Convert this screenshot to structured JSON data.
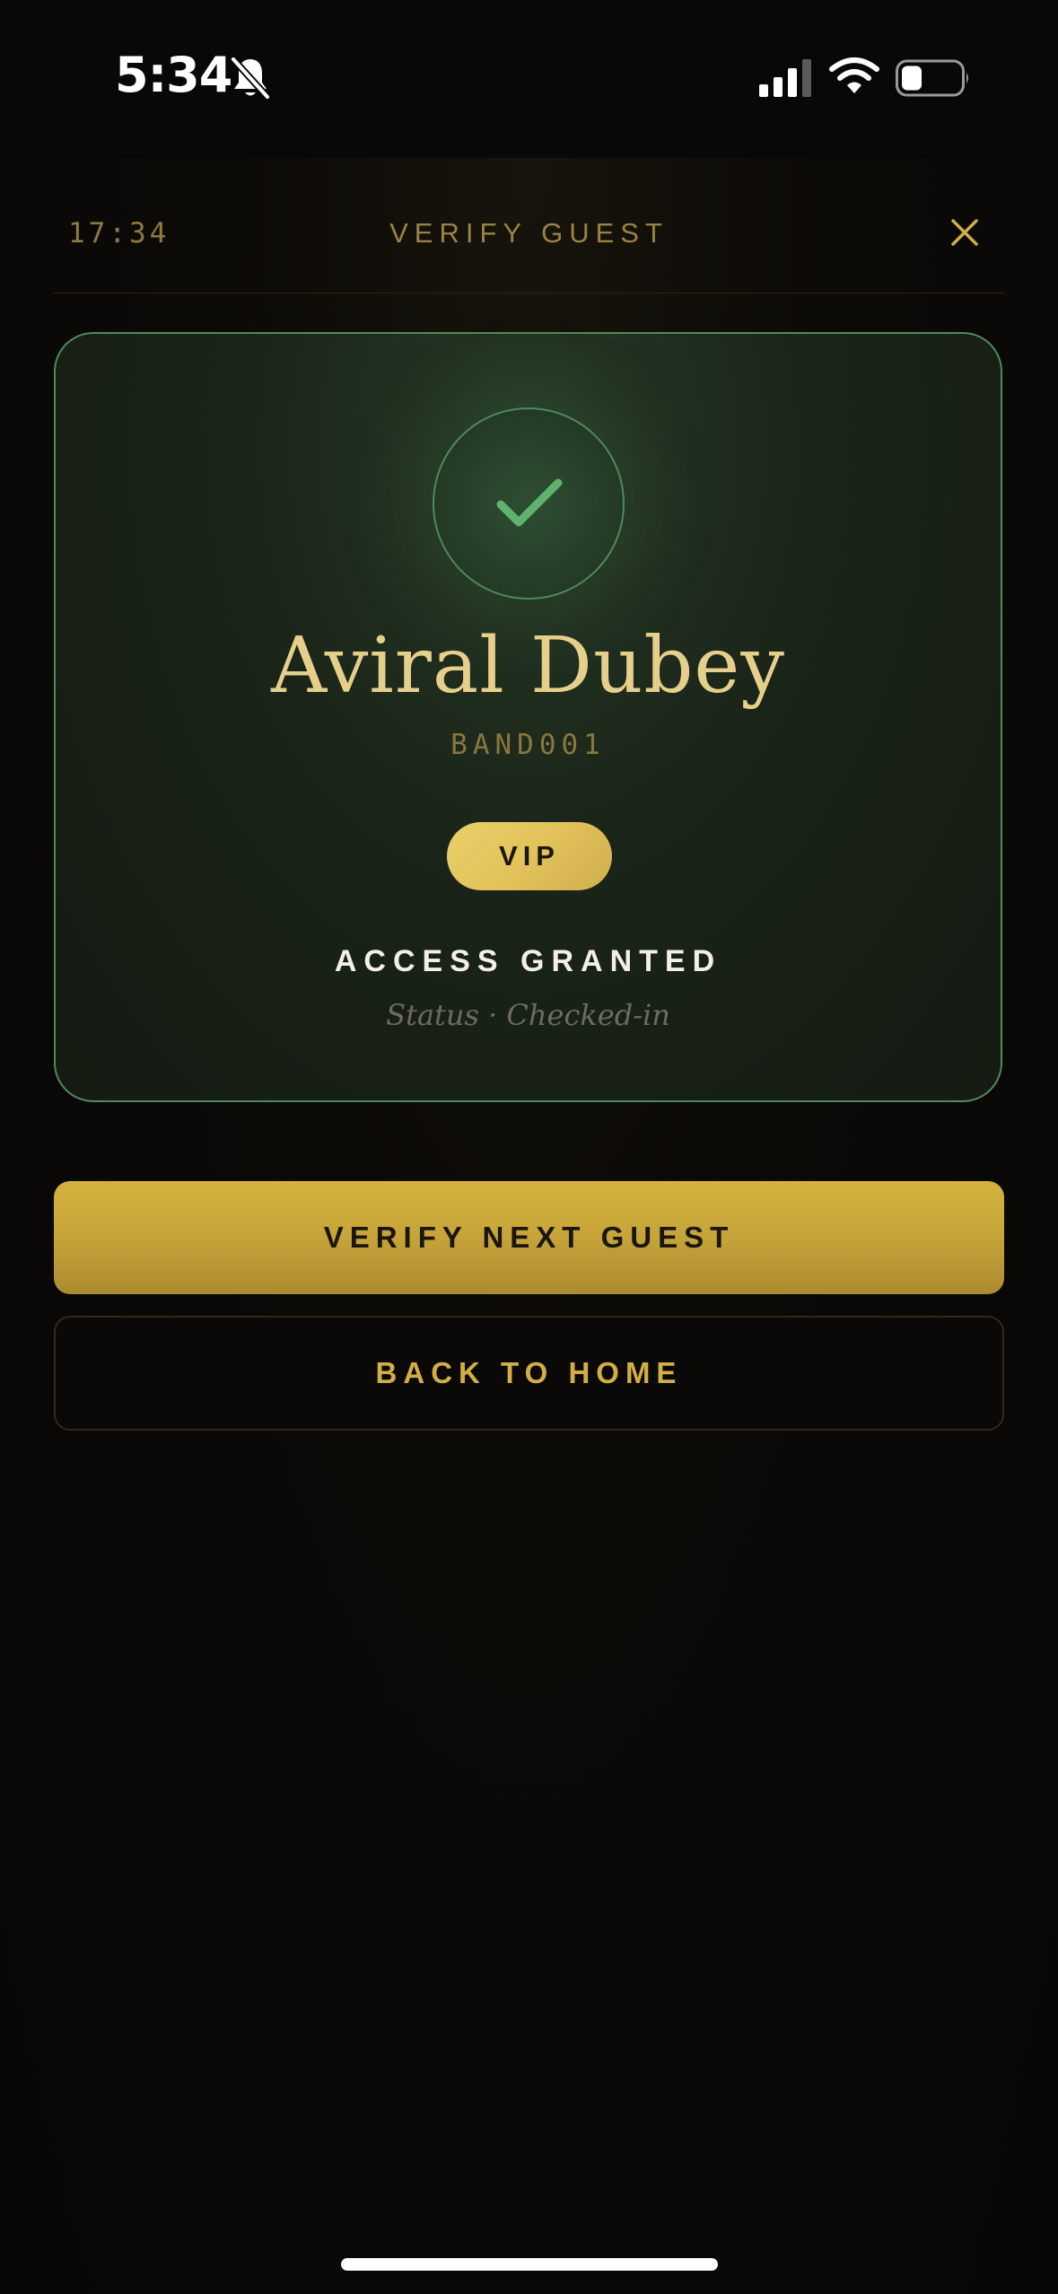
{
  "status_bar": {
    "time": "5:34",
    "icons": [
      "bell-off-icon",
      "signal-icon",
      "wifi-icon",
      "battery-icon"
    ]
  },
  "header": {
    "time": "17:34",
    "title": "VERIFY GUEST",
    "close_icon": "close-icon"
  },
  "result": {
    "icon": "check-icon",
    "guest_name": "Aviral Dubey",
    "guest_id": "BAND001",
    "tier": "VIP",
    "access_status": "ACCESS GRANTED",
    "status_line": "Status · Checked-in"
  },
  "actions": {
    "primary_label": "VERIFY NEXT GUEST",
    "secondary_label": "BACK TO HOME"
  },
  "colors": {
    "accent_gold": "#d4b23d",
    "success_green": "#5fb36f",
    "background": "#080706"
  }
}
